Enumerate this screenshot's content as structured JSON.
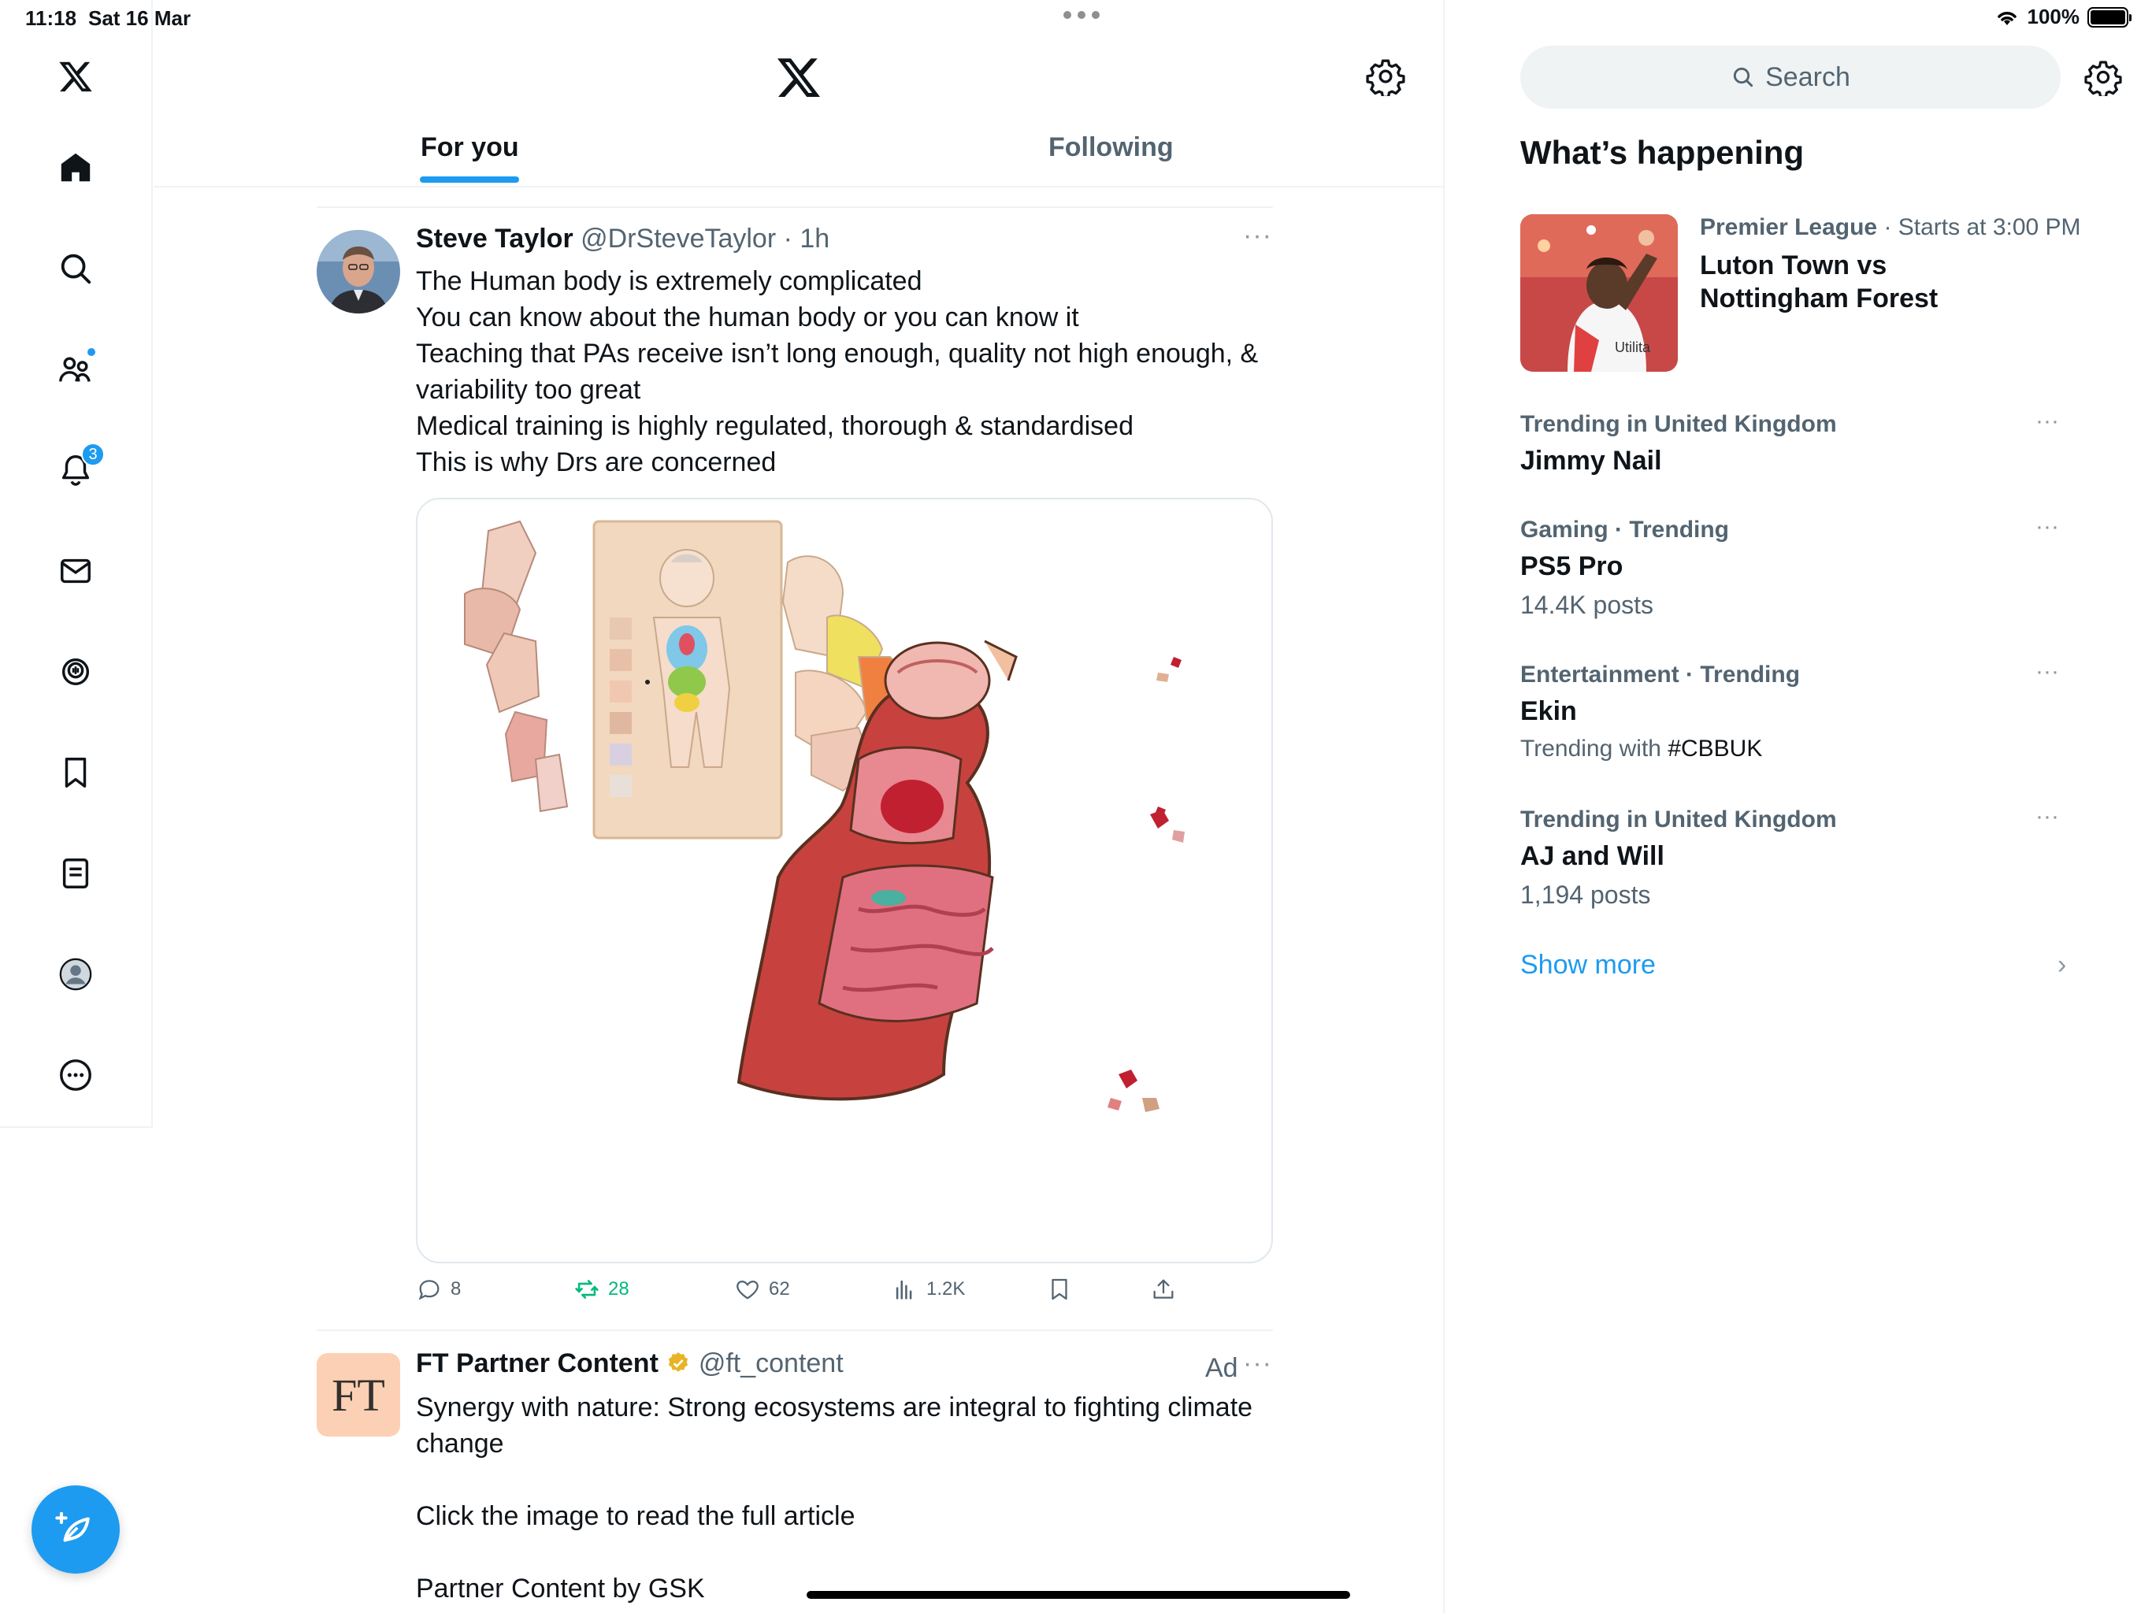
{
  "status_bar": {
    "time": "11:18",
    "date": "Sat 16 Mar",
    "battery": "100%",
    "battery_level": 1.0
  },
  "left_nav": {
    "items": [
      "home",
      "explore",
      "communities",
      "notifications",
      "messages",
      "spaces",
      "bookmarks",
      "lists",
      "profile",
      "more"
    ],
    "notifications_badge": "3"
  },
  "header": {
    "tabs": [
      {
        "label": "For you",
        "selected": true
      },
      {
        "label": "Following",
        "selected": false
      }
    ]
  },
  "tweet": {
    "author_name": "Steve Taylor",
    "handle": "@DrSteveTaylor",
    "time": "· 1h",
    "text_lines": [
      "The Human body is extremely complicated",
      "You can know about the human body or you can know it",
      "Teaching that PAs receive isn’t long enough, quality not high enough, &",
      "variability too great",
      "Medical training is highly regulated, thorough & standardised",
      "This is why Drs are concerned"
    ],
    "replies": "8",
    "retweets": "28",
    "likes": "62",
    "views": "1.2K"
  },
  "ad_tweet": {
    "avatar_text": "FT",
    "author_name": "FT Partner Content",
    "handle": "@ft_content",
    "ad_label": "Ad",
    "text_lines": [
      "Synergy with nature: Strong ecosystems are integral to fighting climate",
      "change",
      "",
      "Click the image to read the full article",
      "",
      "Partner Content by GSK"
    ]
  },
  "right_column": {
    "search_placeholder": "Search",
    "section_title": "What’s happening",
    "event": {
      "league": "Premier League",
      "when": "· Starts at 3:00 PM",
      "title_line1": "Luton Town vs",
      "title_line2": "Nottingham Forest"
    },
    "trends": [
      {
        "meta": "Trending in United Kingdom",
        "title": "Jimmy Nail",
        "sub": ""
      },
      {
        "meta": "Gaming · Trending",
        "title": "PS5 Pro",
        "sub": "14.4K posts"
      },
      {
        "meta": "Entertainment · Trending",
        "title": "Ekin",
        "sub_prefix": "Trending with ",
        "sub_hash": "#CBBUK"
      },
      {
        "meta": "Trending in United Kingdom",
        "title": "AJ and Will",
        "sub": "1,194 posts"
      }
    ],
    "show_more": "Show more"
  },
  "colors": {
    "accent": "#1d9bf0",
    "retweet_green": "#00ba7c",
    "secondary_text": "#536471"
  }
}
